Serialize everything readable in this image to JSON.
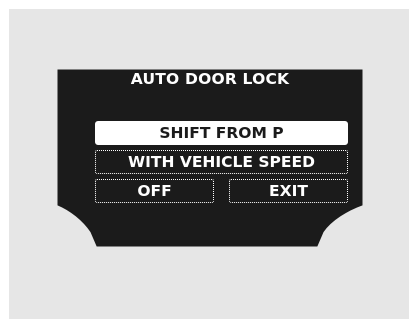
{
  "display": {
    "title": "AUTO DOOR LOCK",
    "selected_option": "SHIFT FROM P",
    "options": [
      {
        "label": "SHIFT FROM P"
      },
      {
        "label": "WITH VEHICLE SPEED"
      },
      {
        "label": "OFF"
      },
      {
        "label": "EXIT"
      }
    ]
  },
  "colors": {
    "panel_background": "#e6e6e6",
    "display_background": "#1b1b1b",
    "text": "#ffffff",
    "selected_background": "#ffffff",
    "selected_text": "#1b1b1b"
  }
}
